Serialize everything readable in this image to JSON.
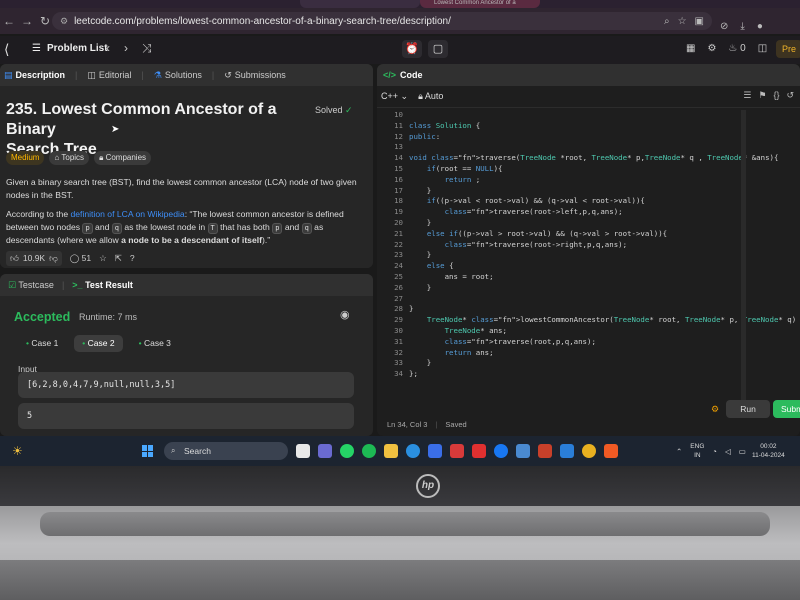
{
  "browser": {
    "tabs": [
      "",
      "Lowest Common Ancestor of a"
    ],
    "url": "leetcode.com/problems/lowest-common-ancestor-of-a-binary-search-tree/description/"
  },
  "header": {
    "problem_list": "Problem List",
    "streak": "0",
    "premium": "Pre"
  },
  "description_panel": {
    "tabs": [
      "Description",
      "Editorial",
      "Solutions",
      "Submissions"
    ],
    "title_line1": "235. Lowest Common Ancestor of a Binary",
    "title_line2": "Search Tree",
    "solved": "Solved",
    "badges": [
      "Medium",
      "Topics",
      "Companies"
    ],
    "para1": "Given a binary search tree (BST), find the lowest common ancestor (LCA) node of two given nodes in the BST.",
    "para2_a": "According to the ",
    "para2_link": "definition of LCA on Wikipedia",
    "para2_b": ": “The lowest common ancestor is defined between two nodes ",
    "code_p": "p",
    "and": " and ",
    "code_q": "q",
    "para2_c": " as the lowest node in ",
    "code_T": "T",
    "para2_d": " that has both ",
    "para2_e": " as descendants (where we allow ",
    "para2_bold": "a node to be a descendant of itself",
    "para2_f": ").”",
    "likes": "10.9K",
    "comments": "51"
  },
  "result_panel": {
    "tabs": [
      "Testcase",
      "Test Result"
    ],
    "status": "Accepted",
    "runtime": "Runtime: 7 ms",
    "cases": [
      "Case 1",
      "Case 2",
      "Case 3"
    ],
    "input_label": "Input",
    "input_value": "[6,2,8,0,4,7,9,null,null,3,5]",
    "output_value": "5"
  },
  "code_panel": {
    "title": "Code",
    "language": "C++",
    "mode": "Auto",
    "line_numbers": [
      "10",
      "11",
      "12",
      "13",
      "14",
      "15",
      "16",
      "17",
      "18",
      "19",
      "20",
      "21",
      "22",
      "23",
      "24",
      "25",
      "26",
      "27",
      "28",
      "29",
      "30",
      "31",
      "32",
      "33",
      "34"
    ],
    "lines": [
      "",
      "class Solution {",
      "public:",
      "",
      "void traverse(TreeNode *root, TreeNode* p,TreeNode* q , TreeNode* &ans){",
      "    if(root == NULL){",
      "        return ;",
      "    }",
      "    if((p->val < root->val) && (q->val < root->val)){",
      "        traverse(root->left,p,q,ans);",
      "    }",
      "    else if((p->val > root->val) && (q->val > root->val)){",
      "        traverse(root->right,p,q,ans);",
      "    }",
      "    else {",
      "        ans = root;",
      "    }",
      "",
      "}",
      "    TreeNode* lowestCommonAncestor(TreeNode* root, TreeNode* p, TreeNode* q) {",
      "        TreeNode* ans;",
      "        traverse(root,p,q,ans);",
      "        return ans;",
      "    }",
      "};"
    ],
    "cursor_pos": "Ln 34, Col 3",
    "saved": "Saved",
    "run": "Run",
    "submit": "Subm"
  },
  "taskbar": {
    "search": "Search",
    "lang_line1": "ENG",
    "lang_line2": "IN",
    "time": "00:02",
    "date": "11-04-2024"
  },
  "brand": "hp"
}
